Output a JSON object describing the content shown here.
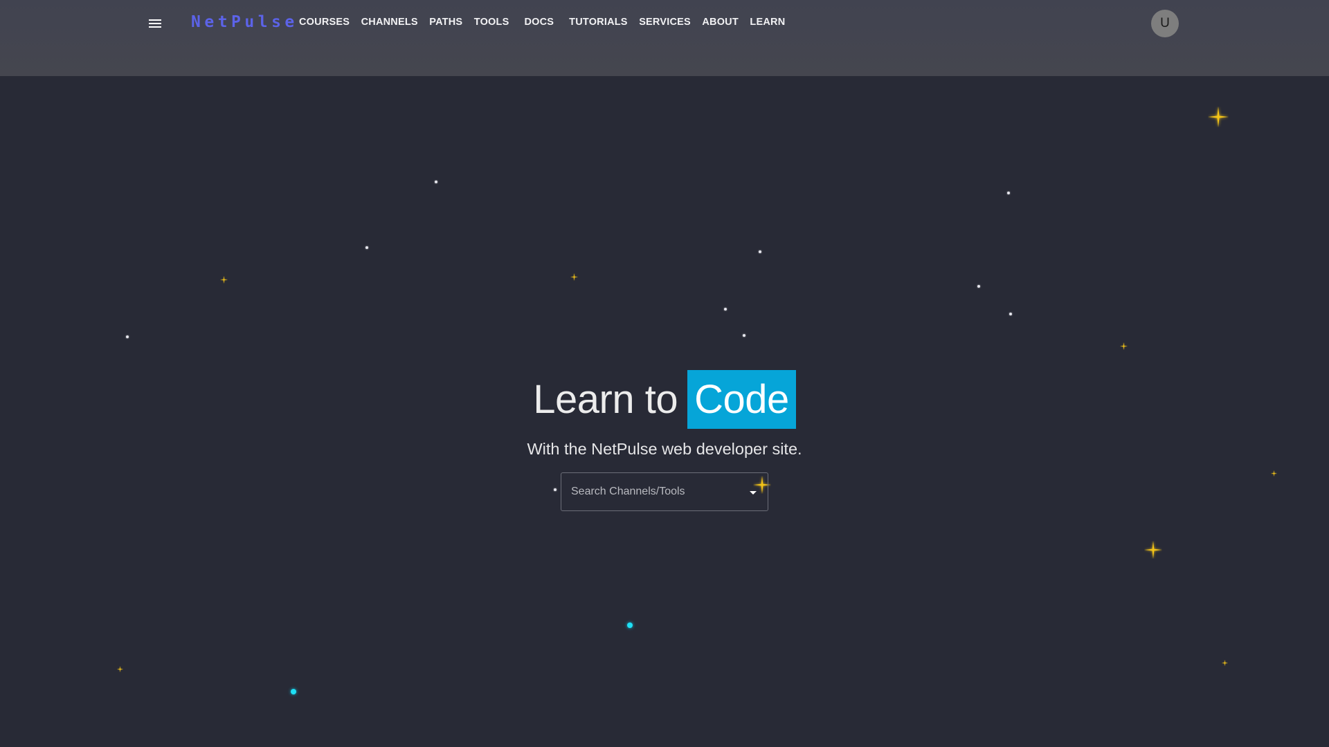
{
  "header": {
    "menu_icon": "hamburger-menu-icon",
    "logo": "NetPulse",
    "nav": [
      {
        "label": "COURSES"
      },
      {
        "label": "CHANNELS"
      },
      {
        "label": "PATHS"
      },
      {
        "label": "TOOLS"
      },
      {
        "label": "DOCS"
      },
      {
        "label": "TUTORIALS"
      },
      {
        "label": "SERVICES"
      },
      {
        "label": "ABOUT"
      },
      {
        "label": "LEARN"
      }
    ],
    "avatar_initial": "U"
  },
  "hero": {
    "title_plain": "Learn to",
    "title_highlight": "Code",
    "subtitle": "With the NetPulse web developer site.",
    "search": {
      "placeholder": "Search Channels/Tools",
      "value": "",
      "dropdown_icon": "caret-down-icon"
    }
  },
  "colors": {
    "header_bg": "#424450",
    "page_bg": "#282a36",
    "logo": "#5c63e8",
    "highlight": "#06a5d8",
    "star_gold": "#f5c518",
    "star_cyan": "#1ee0f5"
  }
}
